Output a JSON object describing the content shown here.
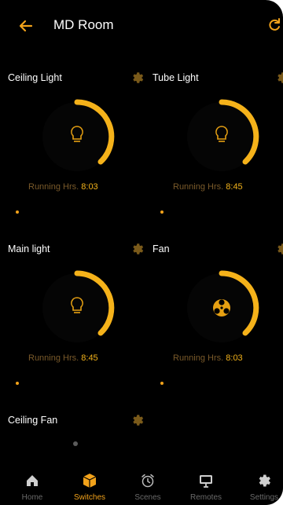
{
  "header": {
    "title": "MD Room",
    "back_icon": "arrow-left-icon",
    "refresh_icon": "refresh-icon",
    "accent": "#f2a21a"
  },
  "switches": [
    {
      "name": "Ceiling Light",
      "icon": "bulb-icon",
      "running_label": "Running Hrs.",
      "running_value": "8:03"
    },
    {
      "name": "Tube Light",
      "icon": "bulb-icon",
      "running_label": "Running Hrs.",
      "running_value": "8:45"
    },
    {
      "name": "Main light",
      "icon": "bulb-icon",
      "running_label": "Running Hrs.",
      "running_value": "8:45"
    },
    {
      "name": "Fan",
      "icon": "fan-icon",
      "running_label": "Running Hrs.",
      "running_value": "8:03"
    }
  ],
  "extra_switch": {
    "name": "Ceiling Fan"
  },
  "bottom_nav": [
    {
      "label": "Home",
      "icon": "home-icon",
      "active": false
    },
    {
      "label": "Switches",
      "icon": "cube-icon",
      "active": true
    },
    {
      "label": "Scenes",
      "icon": "alarm-clock-icon",
      "active": false
    },
    {
      "label": "Remotes",
      "icon": "monitor-icon",
      "active": false
    },
    {
      "label": "Settings",
      "icon": "gear-icon",
      "active": false
    }
  ]
}
